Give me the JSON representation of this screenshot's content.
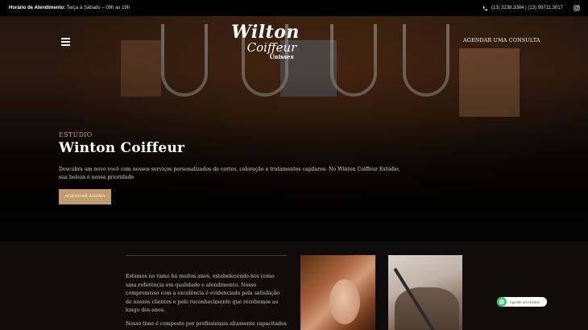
{
  "topbar": {
    "hours_label": "Horário de Atendimento:",
    "hours_value": "Terça à Sábado – 09h as 19h",
    "phones": "(13) 3238.3384 | (13) 99711.3017",
    "phone_icon": "phone-icon",
    "instagram_icon": "instagram-icon"
  },
  "header": {
    "menu_icon": "hamburger-icon",
    "logo": {
      "line1": "Wilton",
      "line2": "Coiffeur",
      "line3": "Unissex"
    },
    "cta": "AGENDAR UMA CONSULTA"
  },
  "hero": {
    "kicker": "ESTÚDIO",
    "title": "Winton Coiffeur",
    "description": "Descubra um novo você com nossos serviços personalizados de cortes, coloração e tratamentos capilares. No Winton Coiffeur Estúdio, sua beleza é nossa prioridade",
    "button": "AGENDAR AGORA"
  },
  "about": {
    "paragraphs": [
      "Estamos no ramo há muitos anos, estabelecendo-nos como uma referência em qualidade e atendimento. Nosso compromisso com a excelência é evidenciado pela satisfação de nossos clientes e pelo reconhecimento que recebemos ao longo dos anos.",
      "Nosso time é composto por profissionais altamente capacitados e especializados, com vasta experiência e treinamento constante para"
    ]
  },
  "whatsapp": {
    "label": "Agende um Horário",
    "icon": "whatsapp-icon"
  },
  "colors": {
    "accent": "#c49a6c",
    "topbar": "#000000",
    "whatsapp": "#25d366"
  }
}
